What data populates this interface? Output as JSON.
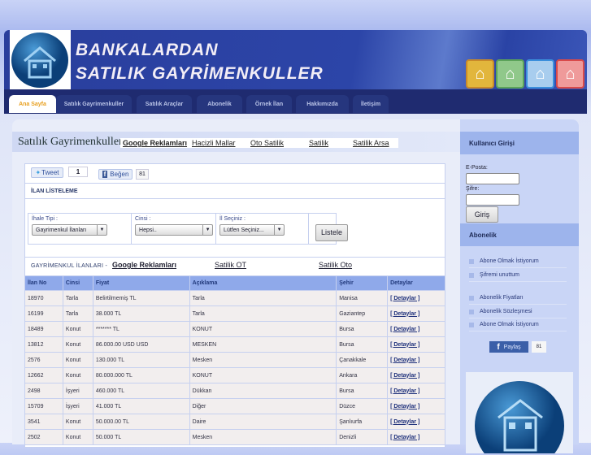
{
  "header": {
    "title_line1": "BANKALARDAN",
    "title_line2": "SATILIK GAYRİMENKULLER",
    "icons": [
      "home-yellow-icon",
      "home-green-icon",
      "home-blue-icon",
      "home-red-icon"
    ]
  },
  "nav": {
    "tabs": [
      "Ana Sayfa",
      "Satılık Gayrimenkuller",
      "Satılık Araçlar",
      "Abonelik",
      "Örnek İlan",
      "Hakkımızda",
      "İletişim"
    ]
  },
  "section": {
    "title": "Satılık Gayrimenkuller",
    "links": [
      "Google Reklamları",
      "Hacizli Mallar",
      "Oto Satilik",
      "Satilik",
      "Satilik Arsa"
    ]
  },
  "social": {
    "tweet": "Tweet",
    "tweet_count": "1",
    "like": "Beğen",
    "like_count": "81"
  },
  "listing": {
    "heading": "İLAN LİSTELEME",
    "filters": [
      {
        "label": "İhale Tipi :",
        "value": "Gayrimenkul İlanları"
      },
      {
        "label": "Cinsi :",
        "value": "Hepsi.."
      },
      {
        "label": "İl Seçiniz :",
        "value": "Lütfen Seçiniz..."
      }
    ],
    "button": "Listele"
  },
  "ads": {
    "heading": "GAYRİMENKUL İLANLARI -",
    "links": [
      "Google Reklamları",
      "Satilik OT",
      "Satilik Oto"
    ]
  },
  "table": {
    "columns": [
      "İlan No",
      "Cinsi",
      "Fiyat",
      "Açıklama",
      "Şehir",
      "Detaylar"
    ],
    "rows": [
      [
        "18970",
        "Tarla",
        "Belirtilmemiş  TL",
        "Tarla",
        "Manisa",
        "[ Detaylar ]"
      ],
      [
        "16199",
        "Tarla",
        "38.000  TL",
        "Tarla",
        "Gaziantep",
        "[ Detaylar ]"
      ],
      [
        "18489",
        "Konut",
        "*******  TL",
        "KONUT",
        "Bursa",
        "[ Detaylar ]"
      ],
      [
        "13812",
        "Konut",
        "86.000.00 USD  USD",
        "MESKEN",
        "Bursa",
        "[ Detaylar ]"
      ],
      [
        "2576",
        "Konut",
        "130.000  TL",
        "Mesken",
        "Çanakkale",
        "[ Detaylar ]"
      ],
      [
        "12662",
        "Konut",
        "80.000.000  TL",
        "KONUT",
        "Ankara",
        "[ Detaylar ]"
      ],
      [
        "2498",
        "İşyeri",
        "460.000  TL",
        "Dükkan",
        "Bursa",
        "[ Detaylar ]"
      ],
      [
        "15709",
        "İşyeri",
        "41.000  TL",
        "Diğer",
        "Düzce",
        "[ Detaylar ]"
      ],
      [
        "3541",
        "Konut",
        "50.000.00  TL",
        "Daire",
        "Şanlıurfa",
        "[ Detaylar ]"
      ],
      [
        "2502",
        "Konut",
        "50.000   TL",
        "Mesken",
        "Denizli",
        "[ Detaylar ]"
      ]
    ]
  },
  "sidebar": {
    "login_title": "Kullanıcı Girişi",
    "email_label": "E-Posta:",
    "password_label": "Şifre:",
    "login_button": "Giriş",
    "sub_title": "Abonelik",
    "items": [
      "Abone Olmak İstiyorum",
      "Şifremi unuttum",
      "Abonelik Fiyatları",
      "Abonelik Sözleşmesi",
      "Abone Olmak İstiyorum"
    ],
    "share": "Paylaş",
    "share_count": "81"
  }
}
